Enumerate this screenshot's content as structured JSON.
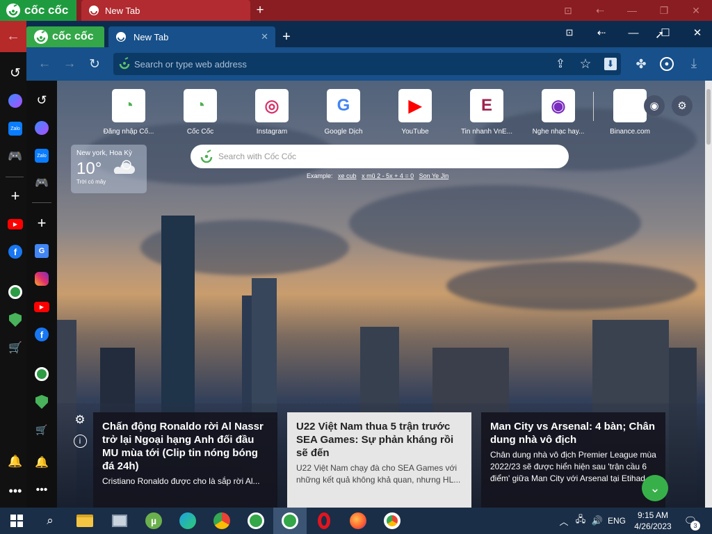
{
  "outer": {
    "brand": "cốc cốc",
    "tab_title": "New Tab",
    "new_tab": "+",
    "btn_screenshot": "⊡",
    "btn_back": "⇠",
    "btn_min": "—",
    "btn_max": "❐",
    "btn_close": "✕",
    "back_arrow": "←"
  },
  "browser": {
    "brand": "cốc cốc",
    "tab_title": "New Tab",
    "tab_close": "✕",
    "new_tab": "+",
    "btn_min": "—",
    "btn_max": "☐",
    "btn_close": "✕",
    "address_placeholder": "Search or type web address"
  },
  "shortcuts": [
    {
      "label": "Đăng nhập Cố...",
      "icon": "coccoc-icon",
      "glyph": "◔",
      "color": "#4caf50"
    },
    {
      "label": "Cốc Cốc",
      "icon": "coccoc-icon",
      "glyph": "◔",
      "color": "#4caf50"
    },
    {
      "label": "Instagram",
      "icon": "instagram-icon",
      "glyph": "◎",
      "color": "#d6336c"
    },
    {
      "label": "Google Dịch",
      "icon": "google-translate-icon",
      "glyph": "G",
      "color": "#4285f4"
    },
    {
      "label": "YouTube",
      "icon": "youtube-icon",
      "glyph": "▶",
      "color": "#ff0000"
    },
    {
      "label": "Tin nhanh VnE...",
      "icon": "vnexpress-icon",
      "glyph": "E",
      "color": "#9f224e"
    },
    {
      "label": "Nghe nhạc hay...",
      "icon": "music-disc-icon",
      "glyph": "◉",
      "color": "#7b2cbf"
    },
    {
      "label": "Binance.com",
      "icon": "binance-icon",
      "glyph": "",
      "color": "#999999"
    }
  ],
  "weather": {
    "location": "New york, Hoa Kỳ",
    "temperature": "10°",
    "description": "Trời có mây"
  },
  "search": {
    "placeholder": "Search with Cốc Cốc",
    "example_label": "Example:",
    "examples": [
      "xe cub",
      "x mũ 2 - 5x + 4 = 0",
      "Son Ye Jin"
    ]
  },
  "news": [
    {
      "title": "Chấn động Ronaldo rời Al Nassr trở lại Ngoại hạng Anh đối đầu MU mùa tới (Clip tin nóng bóng đá 24h)",
      "summary": "Cristiano Ronaldo được cho là sắp rời Al..."
    },
    {
      "title": "U22 Việt Nam thua 5 trận trước SEA Games: Sự phản kháng rồi sẽ đến",
      "summary": "U22 Việt Nam chạy đà cho SEA Games với những kết quả không khả quan, nhưng HL..."
    },
    {
      "title": "Man City vs Arsenal: 4 bàn; Chân dung nhà vô địch",
      "summary": "Chân dung nhà vô địch Premier League mùa 2022/23 sẽ được hiển hiện sau 'trận cầu 6 điểm' giữa Man City với Arsenal tại Etihad"
    }
  ],
  "taskbar": {
    "language": "ENG",
    "time": "9:15 AM",
    "date": "4/26/2023",
    "notification_count": "3"
  }
}
